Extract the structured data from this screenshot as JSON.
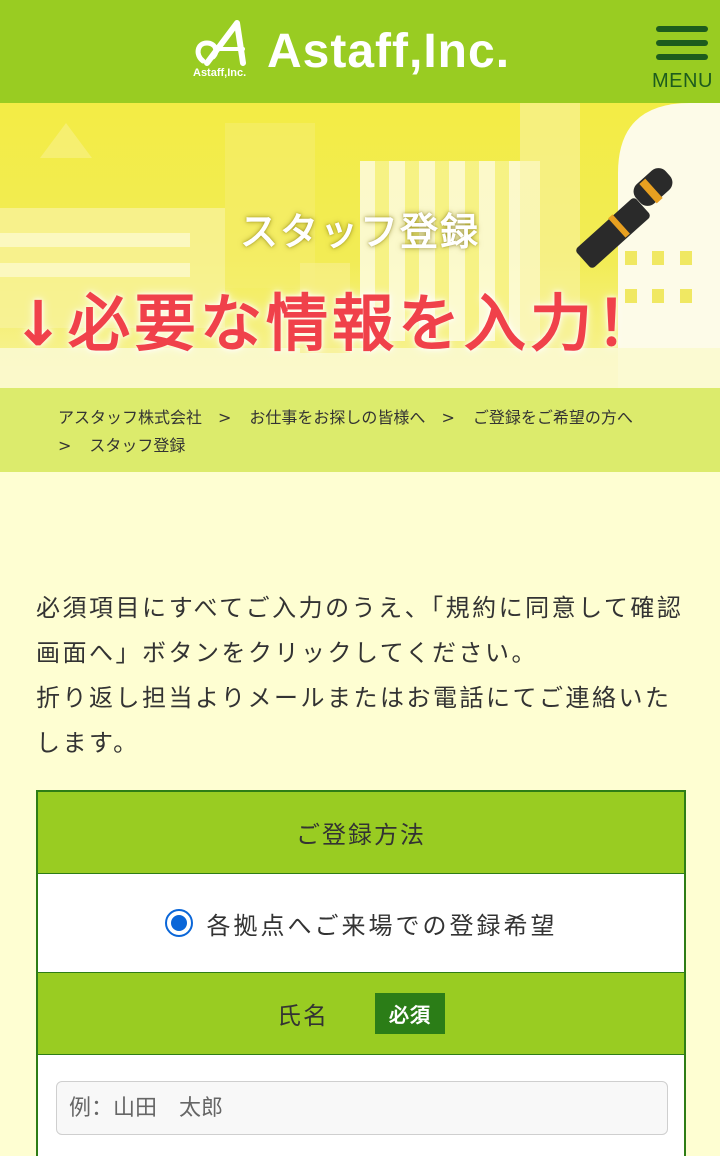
{
  "header": {
    "brand_name": "Astaff,Inc.",
    "brand_small": "Astaff,Inc.",
    "menu_label": "MENU",
    "background_color": "#99cc22"
  },
  "hero": {
    "title": "スタッフ登録",
    "subtitle": "↓必要な情報を入力！",
    "subtitle_color": "#f0414a"
  },
  "breadcrumb": {
    "items": [
      "アスタッフ株式会社",
      "お仕事をお探しの皆様へ",
      "ご登録をご希望の方へ",
      "スタッフ登録"
    ],
    "separator": ">"
  },
  "intro": {
    "text": "必須項目にすべてご入力のうえ、「規約に同意して確認画面へ」ボタンをクリックしてください。\n折り返し担当よりメールまたはお電話にてご連絡いたします。"
  },
  "form": {
    "method_label": "ご登録方法",
    "method_option": "各拠点へご来場での登録希望",
    "method_selected": true,
    "name_label": "氏名",
    "required_badge": "必須",
    "name_placeholder": "例：山田　太郎"
  }
}
